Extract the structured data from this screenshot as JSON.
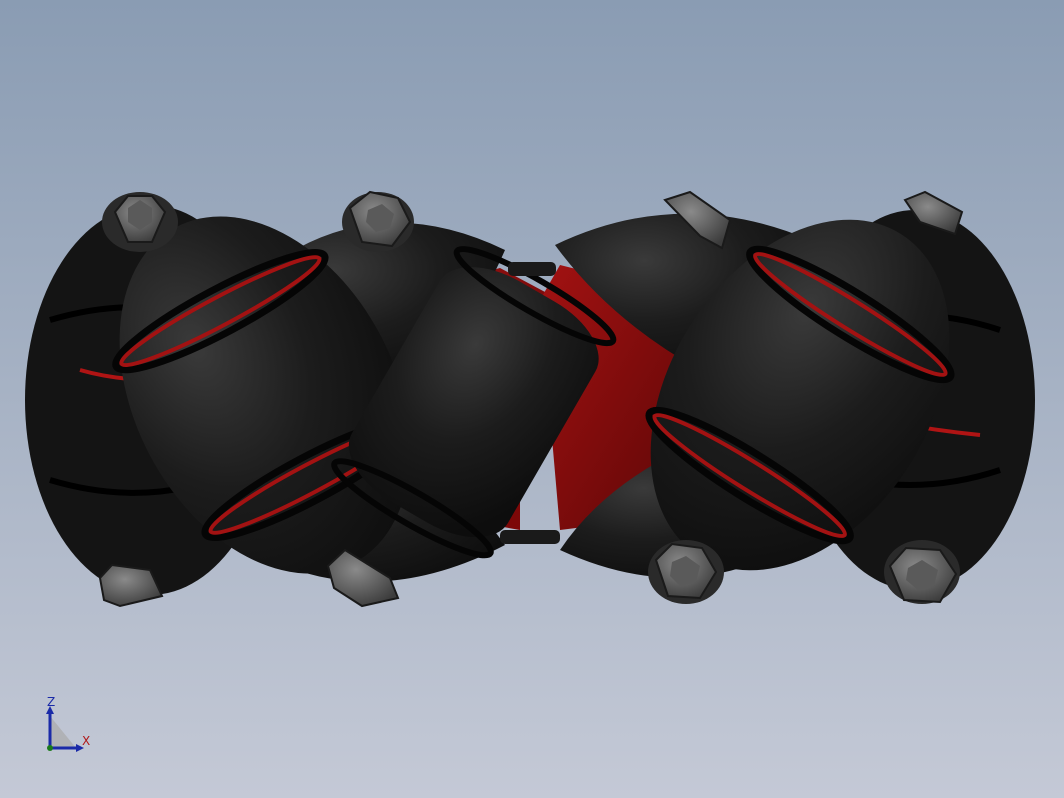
{
  "viewport": {
    "background_top": "#8a9cb3",
    "background_bottom": "#c4c9d6"
  },
  "model": {
    "name": "mecanum-wheel",
    "roller_count_visible": 8,
    "colors": {
      "roller": "#151515",
      "roller_highlight": "#3a3a3a",
      "hub": "#7a0a0a",
      "hub_highlight": "#b01414",
      "bolt": "#505050",
      "bolt_highlight": "#7a7a7a"
    }
  },
  "triad": {
    "z_label": "Z",
    "x_label": "X",
    "z_color": "#1a2aa8",
    "x_color": "#b01818"
  }
}
